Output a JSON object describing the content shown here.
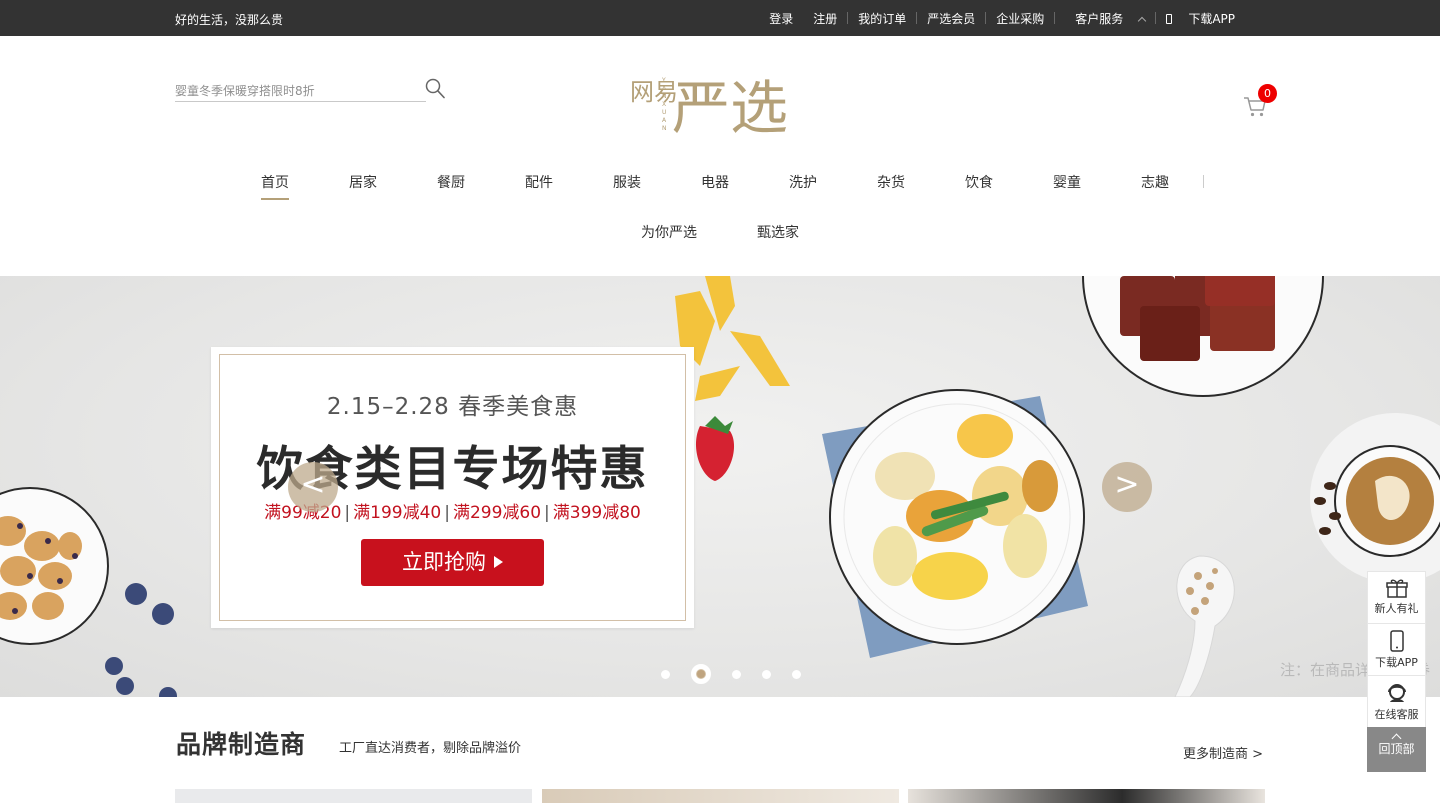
{
  "topbar": {
    "slogan": "好的生活，没那么贵",
    "links": [
      "登录",
      "注册",
      "我的订单",
      "严选会员",
      "企业采购",
      "客户服务",
      "下载APP"
    ]
  },
  "search": {
    "placeholder": "婴童冬季保暖穿搭限时8折"
  },
  "logo": {
    "text_small": "网易",
    "text_big": "严选",
    "pinyin": "YANXUAN",
    "color": "#b4a078"
  },
  "cart": {
    "count": "0"
  },
  "nav": {
    "primary": [
      "首页",
      "居家",
      "餐厨",
      "配件",
      "服装",
      "电器",
      "洗护",
      "杂货",
      "饮食",
      "婴童",
      "志趣"
    ],
    "secondary": [
      "为你严选",
      "甄选家"
    ],
    "active_index": 0
  },
  "banner": {
    "date": "2.15–2.28 春季美食惠",
    "headline": "饮食类目专场特惠",
    "offers": [
      "满99减20",
      "满199减40",
      "满299减60",
      "满399减80"
    ],
    "cta": "立即抢购",
    "prev": "<",
    "next": ">",
    "note": "注：在商品详情页领券",
    "slide_count": 5,
    "active_slide": 1,
    "accent_color": "#c8111d"
  },
  "sidebar": {
    "items": [
      "新人有礼",
      "下载APP",
      "在线客服"
    ],
    "top": "回顶部"
  },
  "brand": {
    "title": "品牌制造商",
    "subtitle": "工厂直达消费者，剔除品牌溢价",
    "more": "更多制造商 >"
  }
}
